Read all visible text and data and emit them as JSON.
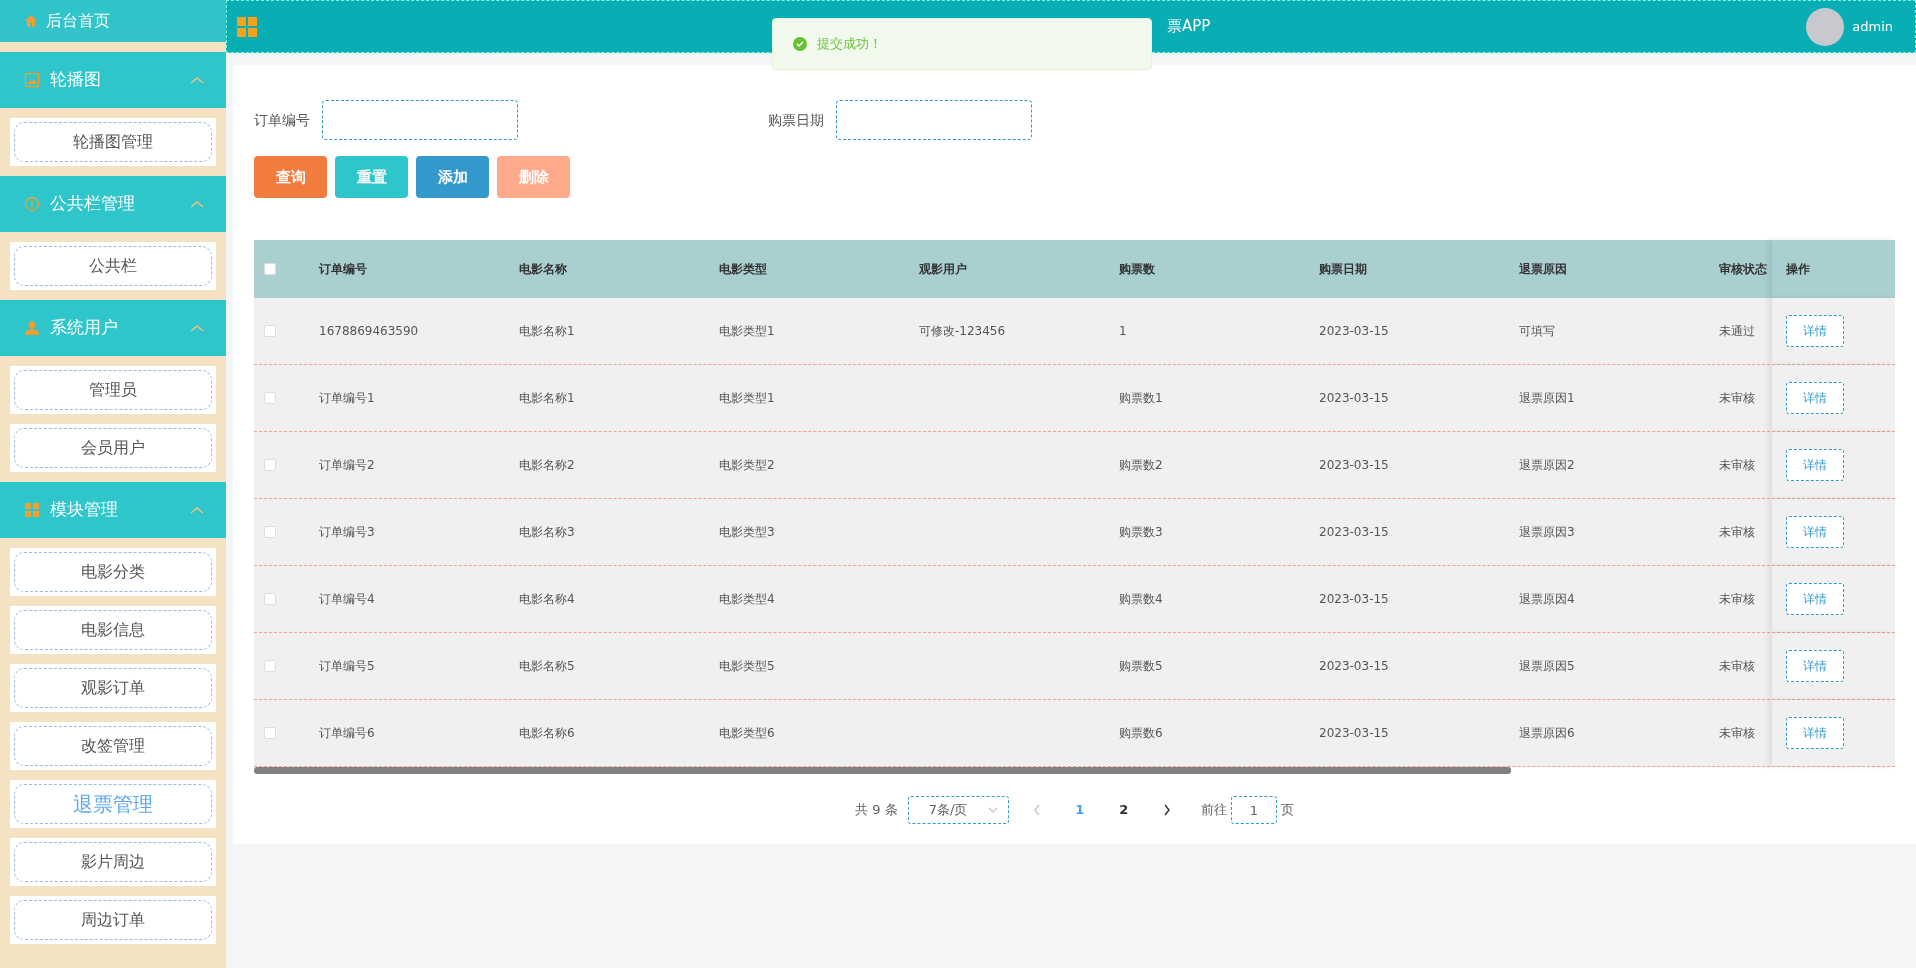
{
  "sidebar": {
    "home": "后台首页",
    "groups": [
      {
        "title": "轮播图",
        "expanded": true,
        "items": [
          {
            "label": "轮播图管理",
            "selected": false
          }
        ]
      },
      {
        "title": "公共栏管理",
        "expanded": true,
        "items": [
          {
            "label": "公共栏",
            "selected": false
          }
        ]
      },
      {
        "title": "系统用户",
        "expanded": true,
        "items": [
          {
            "label": "管理员",
            "selected": false
          },
          {
            "label": "会员用户",
            "selected": false
          }
        ]
      },
      {
        "title": "模块管理",
        "expanded": true,
        "items": [
          {
            "label": "电影分类",
            "selected": false
          },
          {
            "label": "电影信息",
            "selected": false
          },
          {
            "label": "观影订单",
            "selected": false
          },
          {
            "label": "改签管理",
            "selected": false
          },
          {
            "label": "退票管理",
            "selected": true
          },
          {
            "label": "影片周边",
            "selected": false
          },
          {
            "label": "周边订单",
            "selected": false
          }
        ]
      }
    ]
  },
  "topbar": {
    "title": "票APP",
    "user": "admin"
  },
  "toast": {
    "message": "提交成功！"
  },
  "search": {
    "fields": [
      {
        "label": "订单编号"
      },
      {
        "label": "购票日期"
      }
    ],
    "buttons": [
      {
        "label": "查询",
        "kind": "query",
        "disabled": false
      },
      {
        "label": "重置",
        "kind": "reset",
        "disabled": false
      },
      {
        "label": "添加",
        "kind": "add",
        "disabled": false
      },
      {
        "label": "删除",
        "kind": "delete",
        "disabled": true
      }
    ]
  },
  "table": {
    "select_all": false,
    "columns": [
      "订单编号",
      "电影名称",
      "电影类型",
      "观影用户",
      "购票数",
      "购票日期",
      "退票原因",
      "审核状态",
      "操作"
    ],
    "rows": [
      {
        "selected": false,
        "cells": [
          "1678869463590",
          "电影名称1",
          "电影类型1",
          "可修改-123456",
          "1",
          "2023-03-15",
          "可填写",
          "未通过"
        ],
        "action": "详情"
      },
      {
        "selected": false,
        "cells": [
          "订单编号1",
          "电影名称1",
          "电影类型1",
          "",
          "购票数1",
          "2023-03-15",
          "退票原因1",
          "未审核"
        ],
        "action": "详情"
      },
      {
        "selected": false,
        "cells": [
          "订单编号2",
          "电影名称2",
          "电影类型2",
          "",
          "购票数2",
          "2023-03-15",
          "退票原因2",
          "未审核"
        ],
        "action": "详情"
      },
      {
        "selected": false,
        "cells": [
          "订单编号3",
          "电影名称3",
          "电影类型3",
          "",
          "购票数3",
          "2023-03-15",
          "退票原因3",
          "未审核"
        ],
        "action": "详情"
      },
      {
        "selected": false,
        "cells": [
          "订单编号4",
          "电影名称4",
          "电影类型4",
          "",
          "购票数4",
          "2023-03-15",
          "退票原因4",
          "未审核"
        ],
        "action": "详情"
      },
      {
        "selected": false,
        "cells": [
          "订单编号5",
          "电影名称5",
          "电影类型5",
          "",
          "购票数5",
          "2023-03-15",
          "退票原因5",
          "未审核"
        ],
        "action": "详情"
      },
      {
        "selected": false,
        "cells": [
          "订单编号6",
          "电影名称6",
          "电影类型6",
          "",
          "购票数6",
          "2023-03-15",
          "退票原因6",
          "未审核"
        ],
        "action": "详情"
      }
    ]
  },
  "pagination": {
    "total": "共 9 条",
    "page_size": "7条/页",
    "pages": [
      {
        "label": "1",
        "selected": true
      },
      {
        "label": "2",
        "selected": false
      }
    ],
    "goto_label": "前往",
    "goto_value": "1",
    "goto_suffix": "页"
  }
}
